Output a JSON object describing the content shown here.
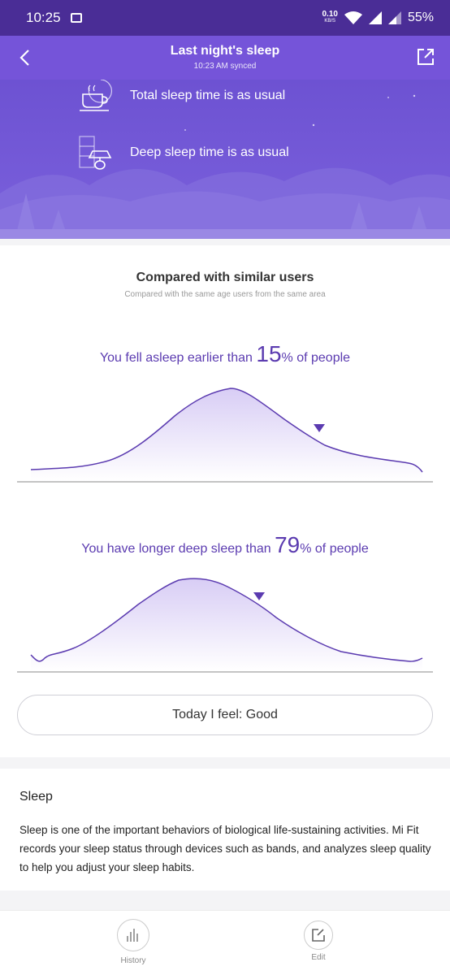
{
  "status_bar": {
    "time": "10:25",
    "net_speed": "0.10",
    "net_unit": "KB/S",
    "battery": "55%"
  },
  "header": {
    "title": "Last night's sleep",
    "synced": "10:23 AM synced"
  },
  "hero": {
    "items": [
      {
        "icon": "coffee-cup-icon",
        "text": "Total sleep time is as usual"
      },
      {
        "icon": "bedside-lamp-icon",
        "text": "Deep sleep time is as usual"
      }
    ]
  },
  "comparison": {
    "title": "Compared with similar users",
    "subtitle": "Compared with the same age users from the same area",
    "stats": [
      {
        "prefix": "You fell asleep earlier than ",
        "value": "15",
        "suffix": "% of people",
        "marker_fraction": 0.74
      },
      {
        "prefix": "You have longer deep sleep than ",
        "value": "79",
        "suffix": "% of people",
        "marker_fraction": 0.57
      }
    ],
    "feel_button": "Today I feel: Good"
  },
  "info": {
    "title": "Sleep",
    "description": "Sleep is one of the important behaviors of biological life-sustaining activities. Mi Fit records your sleep status through devices such as bands, and analyzes sleep quality to help you adjust your sleep habits."
  },
  "tabs": [
    {
      "label": "History",
      "icon": "bar-chart-icon"
    },
    {
      "label": "Edit",
      "icon": "edit-icon"
    }
  ],
  "colors": {
    "header": "#7554d9",
    "status_bar": "#4a2d96",
    "accent": "#5b3bb0"
  }
}
